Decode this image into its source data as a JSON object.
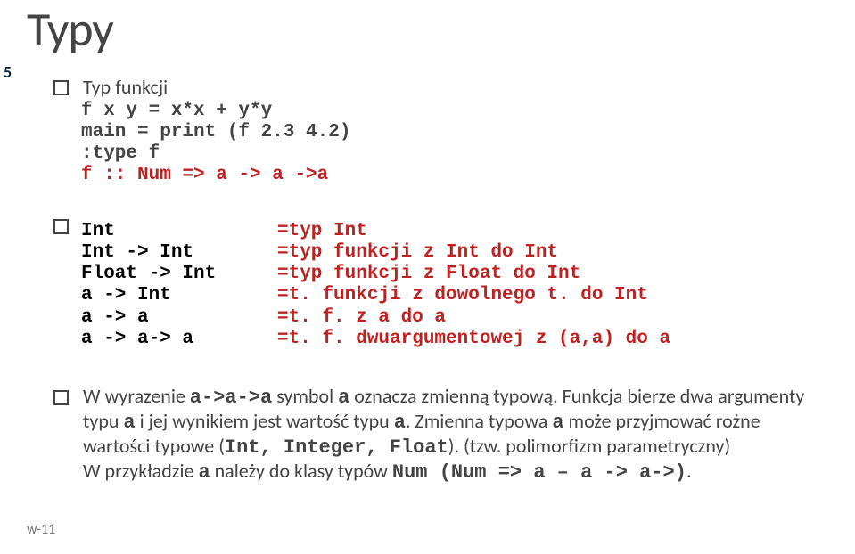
{
  "title": "Typy",
  "slide_number": "5",
  "footer": "w-11",
  "block1": {
    "heading": "Typ funkcji",
    "lines": [
      "f x y = x*x + y*y",
      "main = print (f 2.3 4.2)",
      ":type f"
    ],
    "redline": "f :: Num => a -> a ->a"
  },
  "table": [
    {
      "l": "Int",
      "r": "=typ Int"
    },
    {
      "l": "Int -> Int",
      "r": "=typ funkcji z Int do Int"
    },
    {
      "l": "Float -> Int",
      "r": "=typ funkcji z Float do Int"
    },
    {
      "l": "a -> Int",
      "r": "=t. funkcji z dowolnego t. do Int"
    },
    {
      "l": "a -> a",
      "r": "=t. f. z a do a"
    },
    {
      "l": "a -> a-> a",
      "r": "=t. f. dwuargumentowej z (a,a) do a"
    }
  ],
  "para": {
    "p1a": "W wyrazenie ",
    "p1b": "a->a->a",
    "p1c": "  symbol  ",
    "p1d": "a",
    "p1e": "  oznacza  zmienną  typową. Funkcja bierze dwa argumenty typu ",
    "p1f": "a",
    "p1g": " i jej wynikiem jest wartość typu ",
    "p1h": "a",
    "p1i": ". Zmienna typowa ",
    "p1j": "a",
    "p1k": " może przyjmować rożne wartości typowe (",
    "p1l": "Int, Integer, Float",
    "p1m": "). (tzw. polimorfizm parametryczny)",
    "p2a": "W przykładzie ",
    "p2b": "a",
    "p2c": " należy do klasy typów ",
    "p2d": "Num  (Num => a – a -> a->)",
    "p2e": "."
  }
}
